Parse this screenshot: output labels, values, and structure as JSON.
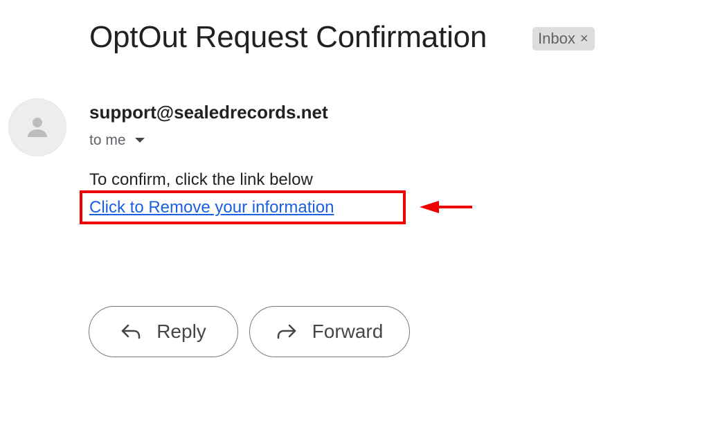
{
  "email": {
    "subject": "OptOut Request Confirmation",
    "label": "Inbox",
    "label_close": "×",
    "sender": "support@sealedrecords.net",
    "recipient": "to me",
    "body_text": "To confirm, click the link below",
    "link_text": "Click to Remove your information"
  },
  "actions": {
    "reply_label": "Reply",
    "forward_label": "Forward"
  },
  "annotation": {
    "highlight_color": "#ee0000",
    "arrow_color": "#ee0000"
  },
  "icons": {
    "avatar": "person-icon",
    "recipient_toggle": "caret-down-icon",
    "reply": "reply-arrow-icon",
    "forward": "forward-arrow-icon",
    "annotation": "left-arrow-icon"
  },
  "colors": {
    "link": "#1a5fe0",
    "chip_bg": "#dddddd",
    "text": "#202124",
    "muted": "#5f6368"
  }
}
